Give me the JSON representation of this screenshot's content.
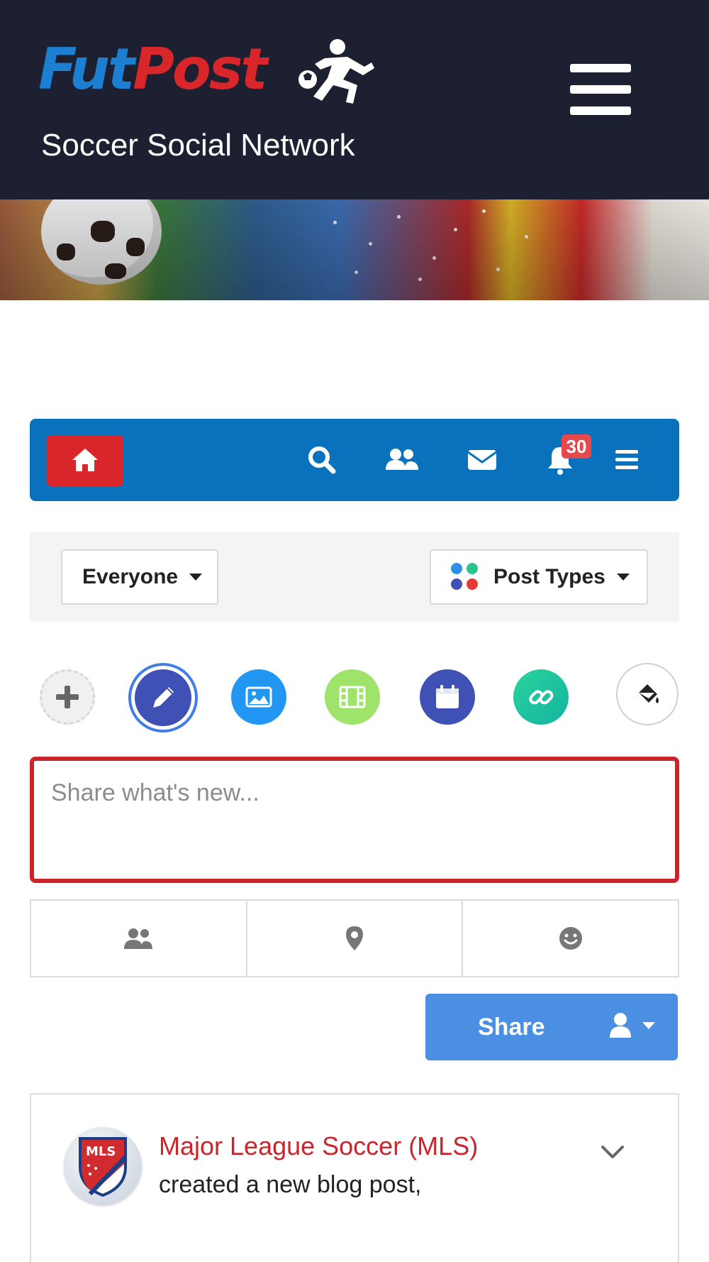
{
  "header": {
    "logo_part1": "Fut",
    "logo_part2": "Post",
    "tagline": "Soccer Social Network",
    "menu_icon": "hamburger-icon"
  },
  "navbar": {
    "home_icon": "home-icon",
    "items": [
      {
        "name": "search",
        "icon": "search-icon"
      },
      {
        "name": "friends",
        "icon": "users-icon"
      },
      {
        "name": "messages",
        "icon": "envelope-icon"
      },
      {
        "name": "notifications",
        "icon": "bell-icon",
        "badge": "30"
      },
      {
        "name": "menu",
        "icon": "bars-icon"
      }
    ]
  },
  "filters": {
    "audience_label": "Everyone",
    "post_types_label": "Post Types"
  },
  "post_types": [
    {
      "name": "add",
      "icon": "plus-icon"
    },
    {
      "name": "status",
      "icon": "pencil-icon",
      "selected": true
    },
    {
      "name": "photo",
      "icon": "image-icon"
    },
    {
      "name": "video",
      "icon": "film-icon"
    },
    {
      "name": "event",
      "icon": "calendar-icon"
    },
    {
      "name": "link",
      "icon": "link-icon"
    },
    {
      "name": "background",
      "icon": "paint-bucket-icon"
    }
  ],
  "composer": {
    "placeholder": "Share what's new...",
    "value": "",
    "actions": [
      {
        "name": "tag-friends",
        "icon": "users-icon"
      },
      {
        "name": "location",
        "icon": "map-marker-icon"
      },
      {
        "name": "feeling",
        "icon": "smile-icon"
      }
    ],
    "share_label": "Share",
    "privacy_icon": "user-icon"
  },
  "feed": [
    {
      "author": "Major League Soccer (MLS)",
      "action": "created a new blog post,",
      "avatar_label": "MLS"
    }
  ],
  "colors": {
    "header_bg": "#1d2030",
    "navbar_bg": "#0a71bc",
    "brand_red": "#d8262a",
    "brand_blue": "#1d7fd1",
    "share_btn": "#4a8fe2",
    "badge": "#e5484d"
  }
}
